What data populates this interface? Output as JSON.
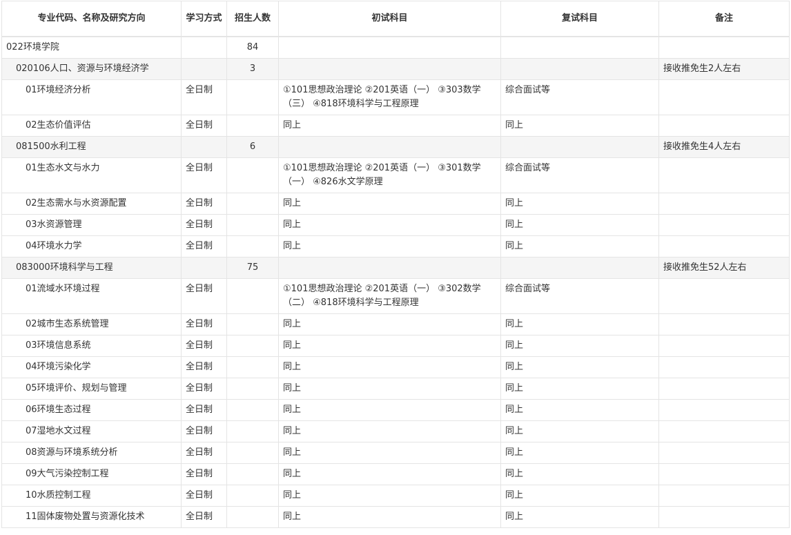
{
  "headers": [
    "专业代码、名称及研究方向",
    "学习方式",
    "招生人数",
    "初试科目",
    "复试科目",
    "备注"
  ],
  "rows": [
    {
      "kind": "college",
      "name": "022环境学院",
      "mode": "",
      "count": "84",
      "exam": "",
      "retest": "",
      "note": ""
    },
    {
      "kind": "major",
      "name": "020106人口、资源与环境经济学",
      "mode": "",
      "count": "3",
      "exam": "",
      "retest": "",
      "note": "接收推免生2人左右"
    },
    {
      "kind": "dir",
      "tall": true,
      "name": "01环境经济分析",
      "mode": "全日制",
      "count": "",
      "exam": "①101思想政治理论 ②201英语（一） ③303数学（三） ④818环境科学与工程原理",
      "retest": "综合面试等",
      "note": ""
    },
    {
      "kind": "dir",
      "name": "02生态价值评估",
      "mode": "全日制",
      "count": "",
      "exam": "同上",
      "retest": "同上",
      "note": ""
    },
    {
      "kind": "major",
      "name": "081500水利工程",
      "mode": "",
      "count": "6",
      "exam": "",
      "retest": "",
      "note": "接收推免生4人左右"
    },
    {
      "kind": "dir",
      "tall": true,
      "name": "01生态水文与水力",
      "mode": "全日制",
      "count": "",
      "exam": "①101思想政治理论 ②201英语（一） ③301数学（一） ④826水文学原理",
      "retest": "综合面试等",
      "note": ""
    },
    {
      "kind": "dir",
      "name": "02生态需水与水资源配置",
      "mode": "全日制",
      "count": "",
      "exam": "同上",
      "retest": "同上",
      "note": ""
    },
    {
      "kind": "dir",
      "name": "03水资源管理",
      "mode": "全日制",
      "count": "",
      "exam": "同上",
      "retest": "同上",
      "note": ""
    },
    {
      "kind": "dir",
      "name": "04环境水力学",
      "mode": "全日制",
      "count": "",
      "exam": "同上",
      "retest": "同上",
      "note": ""
    },
    {
      "kind": "major",
      "name": "083000环境科学与工程",
      "mode": "",
      "count": "75",
      "exam": "",
      "retest": "",
      "note": "接收推免生52人左右"
    },
    {
      "kind": "dir",
      "tall": true,
      "name": "01流域水环境过程",
      "mode": "全日制",
      "count": "",
      "exam": "①101思想政治理论 ②201英语（一） ③302数学（二） ④818环境科学与工程原理",
      "retest": "综合面试等",
      "note": ""
    },
    {
      "kind": "dir",
      "name": "02城市生态系统管理",
      "mode": "全日制",
      "count": "",
      "exam": "同上",
      "retest": "同上",
      "note": ""
    },
    {
      "kind": "dir",
      "name": "03环境信息系统",
      "mode": "全日制",
      "count": "",
      "exam": "同上",
      "retest": "同上",
      "note": ""
    },
    {
      "kind": "dir",
      "name": "04环境污染化学",
      "mode": "全日制",
      "count": "",
      "exam": "同上",
      "retest": "同上",
      "note": ""
    },
    {
      "kind": "dir",
      "name": "05环境评价、规划与管理",
      "mode": "全日制",
      "count": "",
      "exam": "同上",
      "retest": "同上",
      "note": ""
    },
    {
      "kind": "dir",
      "name": "06环境生态过程",
      "mode": "全日制",
      "count": "",
      "exam": "同上",
      "retest": "同上",
      "note": ""
    },
    {
      "kind": "dir",
      "name": "07湿地水文过程",
      "mode": "全日制",
      "count": "",
      "exam": "同上",
      "retest": "同上",
      "note": ""
    },
    {
      "kind": "dir",
      "name": "08资源与环境系统分析",
      "mode": "全日制",
      "count": "",
      "exam": "同上",
      "retest": "同上",
      "note": ""
    },
    {
      "kind": "dir",
      "name": "09大气污染控制工程",
      "mode": "全日制",
      "count": "",
      "exam": "同上",
      "retest": "同上",
      "note": ""
    },
    {
      "kind": "dir",
      "name": "10水质控制工程",
      "mode": "全日制",
      "count": "",
      "exam": "同上",
      "retest": "同上",
      "note": ""
    },
    {
      "kind": "dir",
      "name": "11固体废物处置与资源化技术",
      "mode": "全日制",
      "count": "",
      "exam": "同上",
      "retest": "同上",
      "note": ""
    }
  ]
}
